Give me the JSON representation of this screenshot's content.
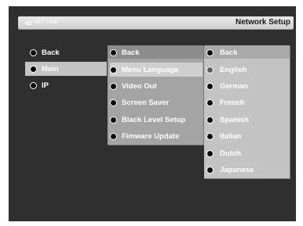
{
  "header": {
    "brand_label": "NET LINK",
    "title": "Network Setup"
  },
  "menu_level1": [
    {
      "label": "Back",
      "selected": false
    },
    {
      "label": "Main",
      "selected": true
    },
    {
      "label": "IP",
      "selected": false
    }
  ],
  "menu_level2": [
    {
      "label": "Back",
      "selected": false
    },
    {
      "label": "Menu Language",
      "selected": true
    },
    {
      "label": "Video Out",
      "selected": false
    },
    {
      "label": "Screen Saver",
      "selected": false
    },
    {
      "label": "Black Level Setup",
      "selected": false
    },
    {
      "label": "Fimware Update",
      "selected": false
    }
  ],
  "menu_level3": [
    {
      "label": "Back",
      "current": false
    },
    {
      "label": "English",
      "current": true
    },
    {
      "label": "German",
      "current": false
    },
    {
      "label": "French",
      "current": false
    },
    {
      "label": "Spanish",
      "current": false
    },
    {
      "label": "Italian",
      "current": false
    },
    {
      "label": "Dutch",
      "current": false
    },
    {
      "label": "Japanese",
      "current": false
    }
  ]
}
